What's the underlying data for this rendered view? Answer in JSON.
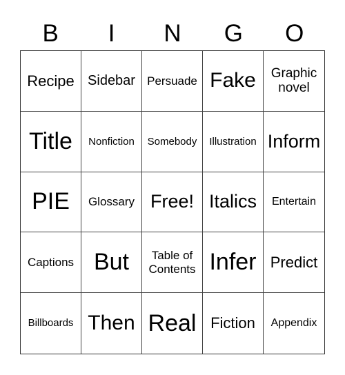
{
  "header": {
    "letters": [
      "B",
      "I",
      "N",
      "G",
      "O"
    ]
  },
  "board": {
    "rows": [
      [
        "Recipe",
        "Sidebar",
        "Persuade",
        "Fake",
        "Graphic\nnovel"
      ],
      [
        "Title",
        "Nonfiction",
        "Somebody",
        "Illustration",
        "Inform"
      ],
      [
        "PIE",
        "Glossary",
        "Free!",
        "Italics",
        "Entertain"
      ],
      [
        "Captions",
        "But",
        "Table of\nContents",
        "Infer",
        "Predict"
      ],
      [
        "Billboards",
        "Then",
        "Real",
        "Fiction",
        "Appendix"
      ]
    ]
  }
}
